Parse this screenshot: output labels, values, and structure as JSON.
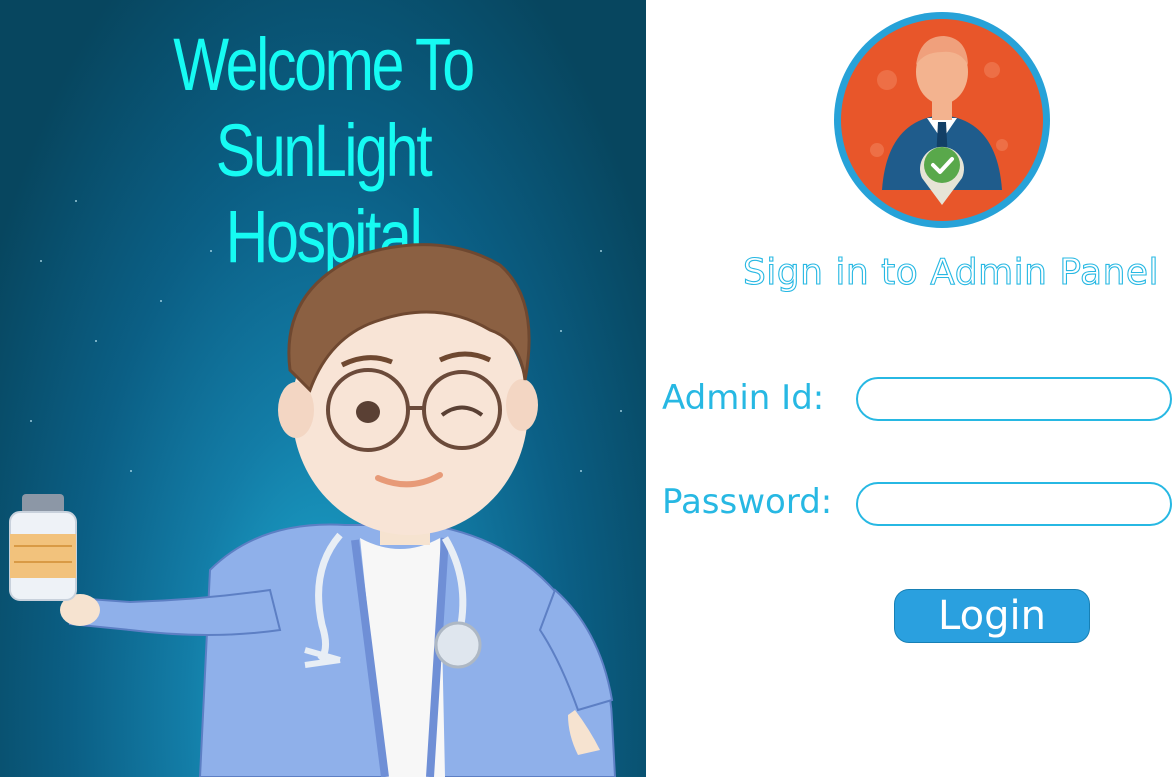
{
  "welcome": {
    "line1": "Welcome To  SunLight",
    "line2": "Hospital"
  },
  "panel": {
    "title": "Sign in to Admin Panel",
    "admin_id_label": "Admin Id:",
    "password_label": "Password:",
    "admin_id_value": "",
    "password_value": "",
    "login_label": "Login"
  },
  "icons": {
    "doctor_illustration": "doctor-illustration",
    "admin_avatar": "admin-verified-avatar-icon"
  },
  "colors": {
    "accent": "#27b8e3",
    "welcome_text": "#16fbf3",
    "login_button": "#2aa0df",
    "background_dark": "#07465f",
    "avatar_circle": "#e8562a"
  }
}
